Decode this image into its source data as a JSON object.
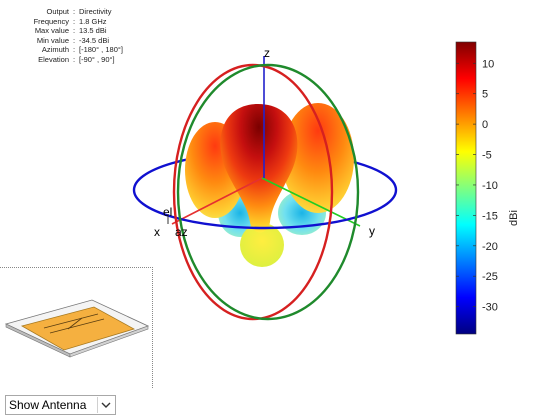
{
  "info": [
    {
      "key": "Output",
      "value": "Directivity"
    },
    {
      "key": "Frequency",
      "value": "1.8 GHz"
    },
    {
      "key": "Max value",
      "value": "13.5 dBi"
    },
    {
      "key": "Min value",
      "value": "-34.5 dBi"
    },
    {
      "key": "Azimuth",
      "value": "[-180° , 180°]"
    },
    {
      "key": "Elevation",
      "value": "[-90° , 90°]"
    }
  ],
  "axes": {
    "x": "x",
    "y": "y",
    "z": "z",
    "az": "az",
    "el": "el"
  },
  "colorbar": {
    "unit": "dBi",
    "min": -34.5,
    "max": 13.5,
    "ticks": [
      10,
      5,
      0,
      -5,
      -10,
      -15,
      -20,
      -25,
      -30
    ],
    "tick_labels": [
      "10",
      "5",
      "0",
      "-5",
      "-10",
      "-15",
      "-20",
      "-25",
      "-30"
    ]
  },
  "colors": {
    "circle_xy": "#1010d0",
    "circle_xz": "#d62020",
    "circle_yz": "#1f8a2c",
    "x_axis": "#e53030",
    "y_axis": "#22cc22",
    "z_axis": "#2222cc"
  },
  "antenna_control": {
    "selected": "Show Antenna",
    "icon": "chevron-down-icon"
  }
}
